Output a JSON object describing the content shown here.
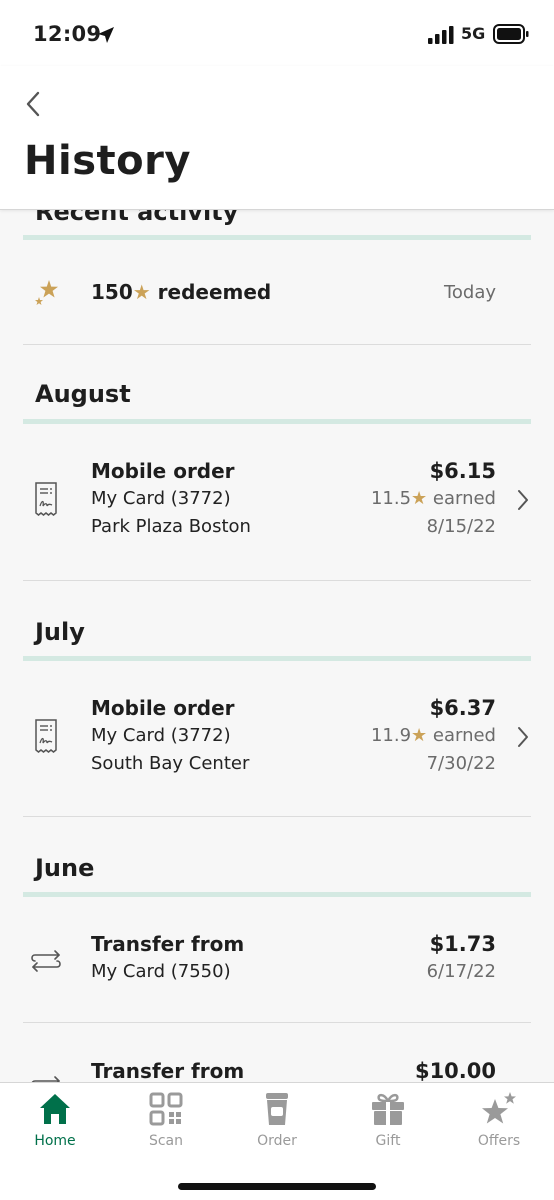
{
  "status_bar": {
    "time": "12:09",
    "network": "5G"
  },
  "header": {
    "title": "History"
  },
  "recent": {
    "section_title": "Recent activity",
    "item": {
      "amount": "150",
      "label": "redeemed",
      "date": "Today"
    }
  },
  "sections": [
    {
      "title": "August",
      "item": {
        "type": "Mobile order",
        "card": "My Card (3772)",
        "store": "Park Plaza Boston",
        "amount": "$6.15",
        "stars": "11.5",
        "earned_label": "earned",
        "date": "8/15/22"
      }
    },
    {
      "title": "July",
      "item": {
        "type": "Mobile order",
        "card": "My Card (3772)",
        "store": "South Bay Center",
        "amount": "$6.37",
        "stars": "11.9",
        "earned_label": "earned",
        "date": "7/30/22"
      }
    },
    {
      "title": "June",
      "items": [
        {
          "type": "Transfer from",
          "card": "My Card (7550)",
          "amount": "$1.73",
          "date": "6/17/22"
        },
        {
          "type": "Transfer from",
          "amount": "$10.00"
        }
      ]
    }
  ],
  "tabs": [
    {
      "label": "Home",
      "icon": "home-icon",
      "active": true
    },
    {
      "label": "Scan",
      "icon": "qr-code-icon"
    },
    {
      "label": "Order",
      "icon": "cup-icon"
    },
    {
      "label": "Gift",
      "icon": "gift-icon"
    },
    {
      "label": "Offers",
      "icon": "stars-icon"
    }
  ],
  "colors": {
    "accent_green": "#00704a",
    "star_gold": "#cba258",
    "section_bar": "#d4e9e2"
  }
}
